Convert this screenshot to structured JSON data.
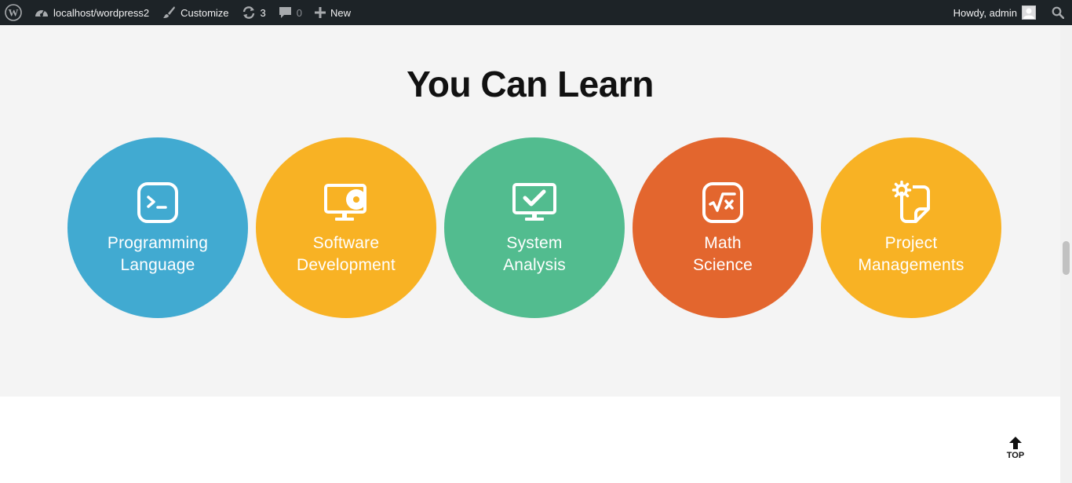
{
  "adminbar": {
    "site_name": "localhost/wordpress2",
    "customize": "Customize",
    "updates_count": "3",
    "comments_count": "0",
    "new_label": "New",
    "howdy": "Howdy, admin"
  },
  "section": {
    "title": "You Can Learn",
    "items": [
      {
        "line1": "Programming",
        "line2": "Language",
        "color": "#41aad1",
        "icon": "terminal-icon"
      },
      {
        "line1": "Software",
        "line2": "Development",
        "color": "#f8b224",
        "icon": "monitor-disc-icon"
      },
      {
        "line1": "System",
        "line2": "Analysis",
        "color": "#52bc8f",
        "icon": "monitor-check-icon"
      },
      {
        "line1": "Math",
        "line2": "Science",
        "color": "#e3662e",
        "icon": "square-root-icon"
      },
      {
        "line1": "Project",
        "line2": "Managements",
        "color": "#f8b224",
        "icon": "gear-note-icon"
      }
    ]
  },
  "back_to_top": "TOP",
  "colors": {
    "adminbar_bg": "#1d2327",
    "section_bg": "#f4f4f4"
  }
}
